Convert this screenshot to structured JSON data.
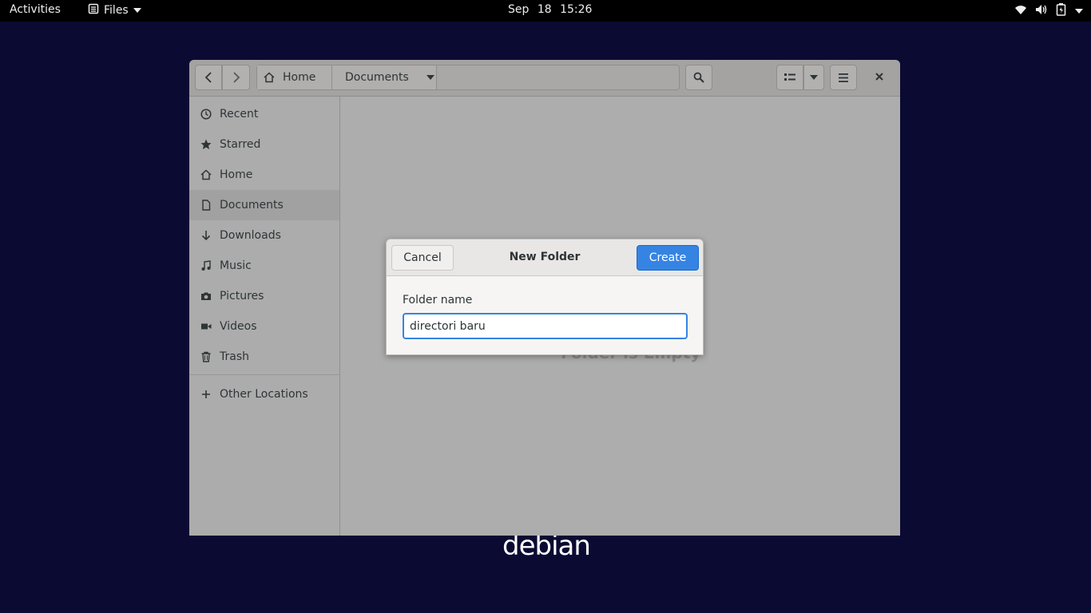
{
  "topbar": {
    "activities": "Activities",
    "app_name": "Files",
    "date": "Sep 18",
    "time": "15:26"
  },
  "window": {
    "path": {
      "home": "Home",
      "current": "Documents"
    },
    "sidebar": {
      "items": [
        {
          "label": "Recent",
          "icon": "clock-icon"
        },
        {
          "label": "Starred",
          "icon": "star-icon"
        },
        {
          "label": "Home",
          "icon": "home-icon"
        },
        {
          "label": "Documents",
          "icon": "document-icon",
          "active": true
        },
        {
          "label": "Downloads",
          "icon": "download-icon"
        },
        {
          "label": "Music",
          "icon": "music-icon"
        },
        {
          "label": "Pictures",
          "icon": "camera-icon"
        },
        {
          "label": "Videos",
          "icon": "video-icon"
        },
        {
          "label": "Trash",
          "icon": "trash-icon"
        }
      ],
      "other_locations": "Other Locations"
    },
    "empty_message": "Folder is Empty"
  },
  "dialog": {
    "title": "New Folder",
    "cancel_label": "Cancel",
    "create_label": "Create",
    "field_label": "Folder name",
    "field_value": "directori baru"
  },
  "branding": {
    "logo_text": "debian"
  },
  "colors": {
    "accent": "#3584e4",
    "desktop": "#0a0a33"
  }
}
